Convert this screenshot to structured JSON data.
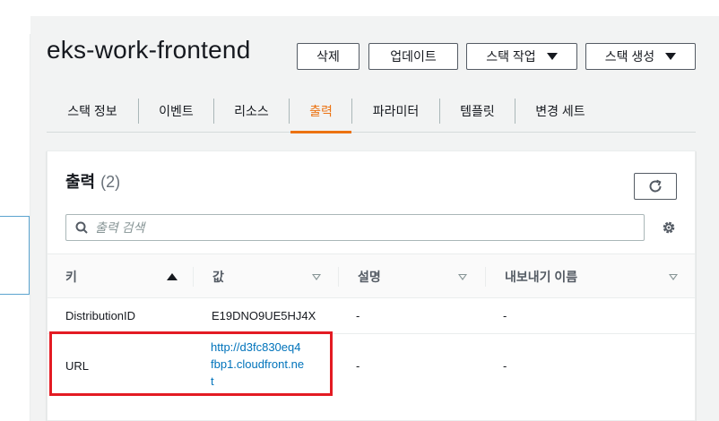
{
  "stack": {
    "title": "eks-work-frontend"
  },
  "actions": {
    "delete_label": "삭제",
    "update_label": "업데이트",
    "stack_actions_label": "스택 작업",
    "create_stack_label": "스택 생성"
  },
  "tabs": [
    {
      "label": "스택 정보",
      "active": false
    },
    {
      "label": "이벤트",
      "active": false
    },
    {
      "label": "리소스",
      "active": false
    },
    {
      "label": "출력",
      "active": true
    },
    {
      "label": "파라미터",
      "active": false
    },
    {
      "label": "템플릿",
      "active": false
    },
    {
      "label": "변경 세트",
      "active": false
    }
  ],
  "outputs": {
    "title": "출력",
    "count": "(2)",
    "search_placeholder": "출력 검색",
    "columns": [
      "키",
      "값",
      "설명",
      "내보내기 이름"
    ],
    "rows": [
      {
        "key": "DistributionID",
        "value": "E19DNO9UE5HJ4X",
        "description": "-",
        "export_name": "-"
      },
      {
        "key": "URL",
        "value_lines": [
          "http://d3fc830eq4",
          "fbp1.cloudfront.ne",
          "t"
        ],
        "description": "-",
        "export_name": "-"
      }
    ]
  },
  "icons": {
    "refresh": "refresh-icon",
    "search": "search-icon",
    "settings": "gear-icon",
    "sort_asc": "sort-ascending-icon",
    "sort_desc": "sort-descending-icon",
    "dropdown": "caret-down-icon"
  },
  "colors": {
    "accent": "#ec7211",
    "link": "#0073bb",
    "highlight": "#e31b23"
  }
}
